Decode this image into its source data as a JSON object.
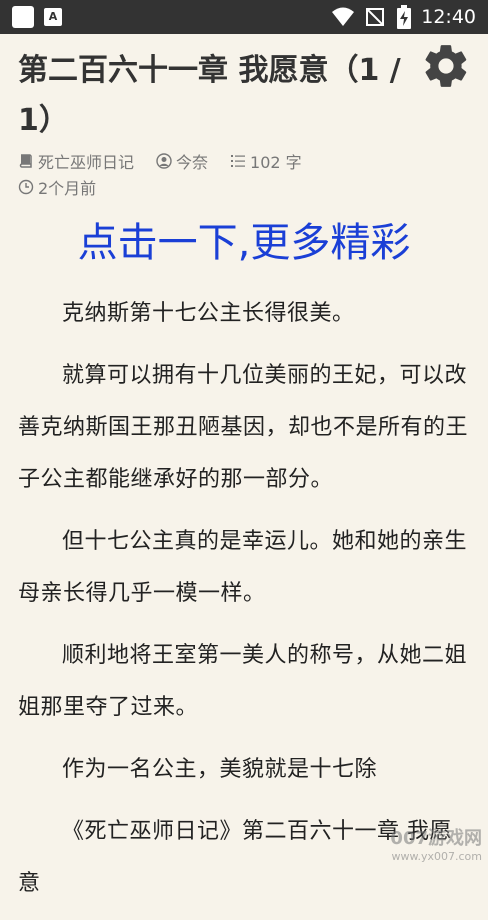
{
  "status_bar": {
    "time": "12:40",
    "notif_a": "A"
  },
  "chapter": {
    "title": "第二百六十一章 我愿意（1 / 1）"
  },
  "meta": {
    "book": "死亡巫师日记",
    "author": "今奈",
    "word_count": "102 字",
    "time_ago": "2个月前"
  },
  "ad_banner": "点击一下,更多精彩",
  "paragraphs": [
    "克纳斯第十七公主长得很美。",
    "就算可以拥有十几位美丽的王妃，可以改善克纳斯国王那丑陋基因，却也不是所有的王子公主都能继承好的那一部分。",
    "但十七公主真的是幸运儿。她和她的亲生母亲长得几乎一模一样。",
    "顺利地将王室第一美人的称号，从她二姐姐那里夺了过来。",
    "作为一名公主，美貌就是十七除",
    "《死亡巫师日记》第二百六十一章 我愿意"
  ],
  "watermark": {
    "brand": "007游戏网",
    "url": "www.yx007.com"
  }
}
